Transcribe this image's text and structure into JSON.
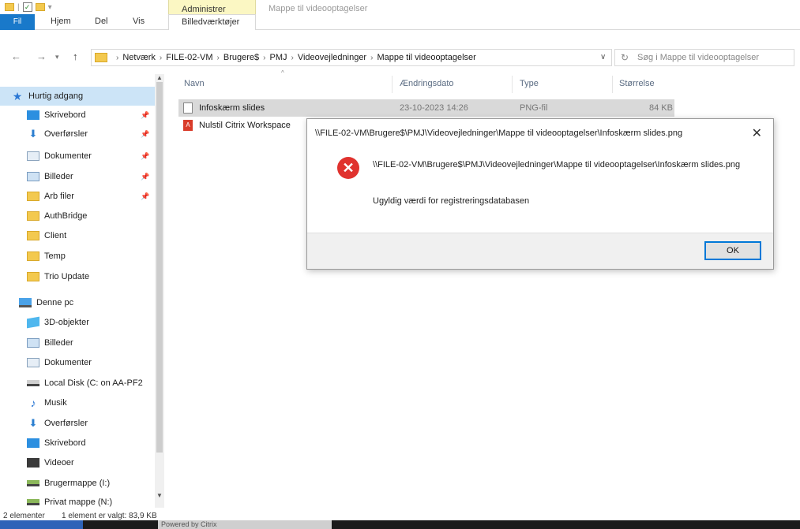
{
  "window": {
    "title": "Mappe til videooptagelser",
    "context_tab_group": "Administrer"
  },
  "ribbon": {
    "tabs": [
      "Fil",
      "Hjem",
      "Del",
      "Vis"
    ],
    "context_tab": "Billedværktøjer"
  },
  "address": {
    "breadcrumb": [
      "Netværk",
      "FILE-02-VM",
      "Brugere$",
      "PMJ",
      "Videovejledninger",
      "Mappe til videooptagelser"
    ],
    "search_placeholder": "Søg i Mappe til videooptagelser"
  },
  "navpane": {
    "items": [
      {
        "label": "Hurtig adgang",
        "icon": "star-icon",
        "pinned": false
      },
      {
        "label": "Skrivebord",
        "icon": "desktop-icon",
        "pinned": true
      },
      {
        "label": "Overførsler",
        "icon": "download-icon",
        "pinned": true
      },
      {
        "label": "Dokumenter",
        "icon": "documents-icon",
        "pinned": true
      },
      {
        "label": "Billeder",
        "icon": "pictures-icon",
        "pinned": true
      },
      {
        "label": "Arb filer",
        "icon": "folder-icon",
        "pinned": true
      },
      {
        "label": "AuthBridge",
        "icon": "folder-icon",
        "pinned": false
      },
      {
        "label": "Client",
        "icon": "folder-icon",
        "pinned": false
      },
      {
        "label": "Temp",
        "icon": "folder-icon",
        "pinned": false
      },
      {
        "label": "Trio Update",
        "icon": "folder-icon",
        "pinned": false
      },
      {
        "label": "Denne pc",
        "icon": "pc-icon",
        "pinned": false
      },
      {
        "label": "3D-objekter",
        "icon": "3d-objects-icon",
        "pinned": false
      },
      {
        "label": "Billeder",
        "icon": "pictures-icon",
        "pinned": false
      },
      {
        "label": "Dokumenter",
        "icon": "documents-icon",
        "pinned": false
      },
      {
        "label": "Local Disk (C: on AA-PF2",
        "icon": "drive-icon",
        "pinned": false
      },
      {
        "label": "Musik",
        "icon": "music-icon",
        "pinned": false
      },
      {
        "label": "Overførsler",
        "icon": "download-icon",
        "pinned": false
      },
      {
        "label": "Skrivebord",
        "icon": "desktop-icon",
        "pinned": false
      },
      {
        "label": "Videoer",
        "icon": "video-icon",
        "pinned": false
      },
      {
        "label": "Brugermappe (I:)",
        "icon": "network-drive-icon",
        "pinned": false
      },
      {
        "label": "Privat mappe (N:)",
        "icon": "network-drive-icon",
        "pinned": false
      }
    ]
  },
  "filelist": {
    "columns": [
      "Navn",
      "Ændringsdato",
      "Type",
      "Størrelse"
    ],
    "rows": [
      {
        "name": "Infoskærm slides",
        "date": "23-10-2023 14:26",
        "type": "PNG-fil",
        "size": "84 KB",
        "selected": true
      },
      {
        "name": "Nulstil Citrix Workspace",
        "date": "",
        "type": "",
        "size": "",
        "selected": false
      }
    ]
  },
  "dialog": {
    "title": "\\\\FILE-02-VM\\Brugere$\\PMJ\\Videovejledninger\\Mappe til videooptagelser\\Infoskærm slides.png",
    "message_path": "\\\\FILE-02-VM\\Brugere$\\PMJ\\Videovejledninger\\Mappe til videooptagelser\\Infoskærm slides.png",
    "message": "Ugyldig værdi for registreringsdatabasen",
    "ok_label": "OK"
  },
  "statusbar": {
    "count": "2 elementer",
    "selection": "1 element er valgt: 83,9 KB"
  },
  "taskbar": {
    "text": "Powered by Citrix"
  }
}
